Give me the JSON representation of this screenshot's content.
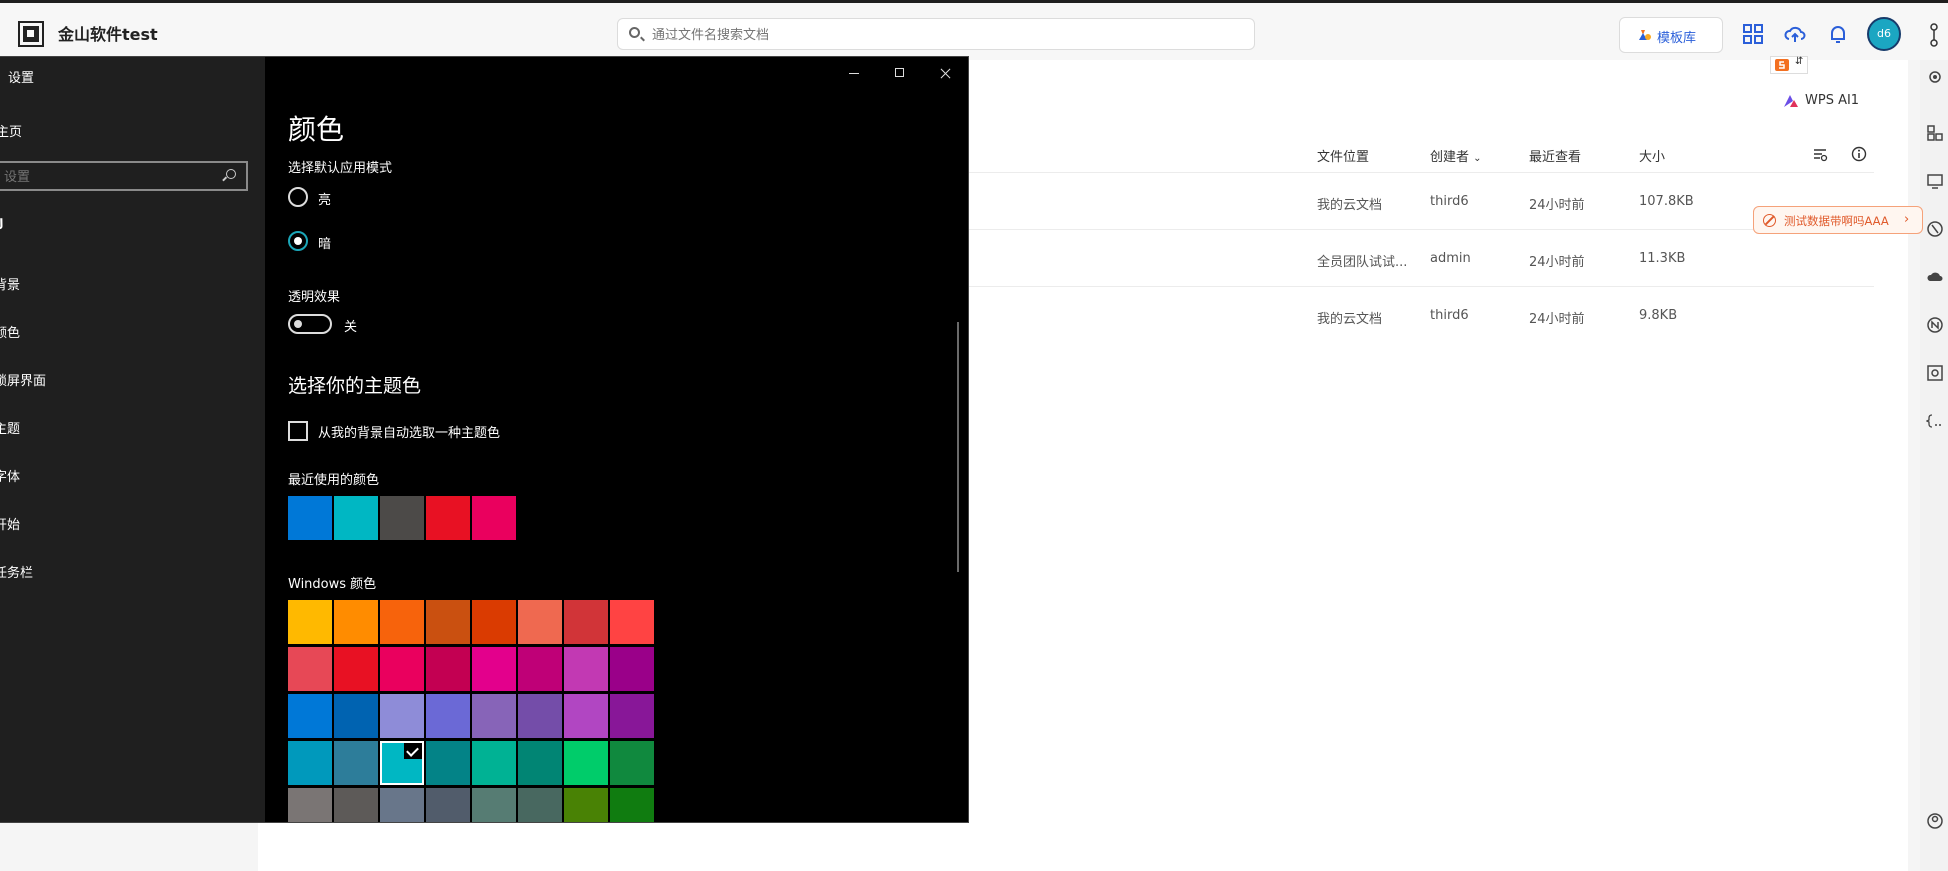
{
  "app": {
    "title": "金山软件test",
    "search_placeholder": "通过文件名搜索文档",
    "template_button": "模板库",
    "avatar_text": "d6",
    "ai_label": "WPS AI1",
    "notice_text": "测试数据带啊吗AAA"
  },
  "file_table": {
    "headers": {
      "location": "文件位置",
      "creator": "创建者",
      "last_viewed": "最近查看",
      "size": "大小"
    },
    "rows": [
      {
        "location": "我的云文档",
        "creator": "third6",
        "last_viewed": "24小时前",
        "size": "107.8KB"
      },
      {
        "location": "全员团队试试...",
        "creator": "admin",
        "last_viewed": "24小时前",
        "size": "11.3KB"
      },
      {
        "location": "我的云文档",
        "creator": "third6",
        "last_viewed": "24小时前",
        "size": "9.8KB"
      }
    ]
  },
  "settings": {
    "window_title": "设置",
    "nav": {
      "home": "主页",
      "search_placeholder": "设置",
      "section_glyph": "ࢴ",
      "items": [
        "背景",
        "颜色",
        "锁屏界面",
        "主题",
        "字体",
        "开始",
        "任务栏"
      ]
    },
    "page_title": "颜色",
    "mode_label": "选择默认应用模式",
    "mode_options": [
      {
        "label": "亮",
        "checked": false
      },
      {
        "label": "暗",
        "checked": true
      }
    ],
    "transparency_label": "透明效果",
    "transparency_state": "关",
    "accent_heading": "选择你的主题色",
    "auto_pick_label": "从我的背景自动选取一种主题色",
    "recent_label": "最近使用的颜色",
    "recent_colors": [
      "#0078d7",
      "#00b7c3",
      "#4c4a48",
      "#e81123",
      "#ea005e"
    ],
    "windows_colors_label": "Windows 颜色",
    "windows_colors": [
      [
        "#ffb900",
        "#ff8c00",
        "#f7630c",
        "#ca5010",
        "#da3b01",
        "#ef6950",
        "#d13438",
        "#ff4343"
      ],
      [
        "#e74856",
        "#e81123",
        "#ea005e",
        "#c30052",
        "#e3008c",
        "#bf0077",
        "#c239b3",
        "#9a0089"
      ],
      [
        "#0078d7",
        "#0063b1",
        "#8e8cd8",
        "#6b69d6",
        "#8764b8",
        "#744da9",
        "#b146c2",
        "#881798"
      ],
      [
        "#0099bc",
        "#2d7d9a",
        "#00b7c3",
        "#038387",
        "#00b294",
        "#018574",
        "#00cc6a",
        "#10893e"
      ],
      [
        "#7a7574",
        "#5d5a58",
        "#68768a",
        "#515c6b",
        "#567c73",
        "#486860",
        "#498205",
        "#107c10"
      ]
    ],
    "selected_color": "#00b7c3"
  }
}
